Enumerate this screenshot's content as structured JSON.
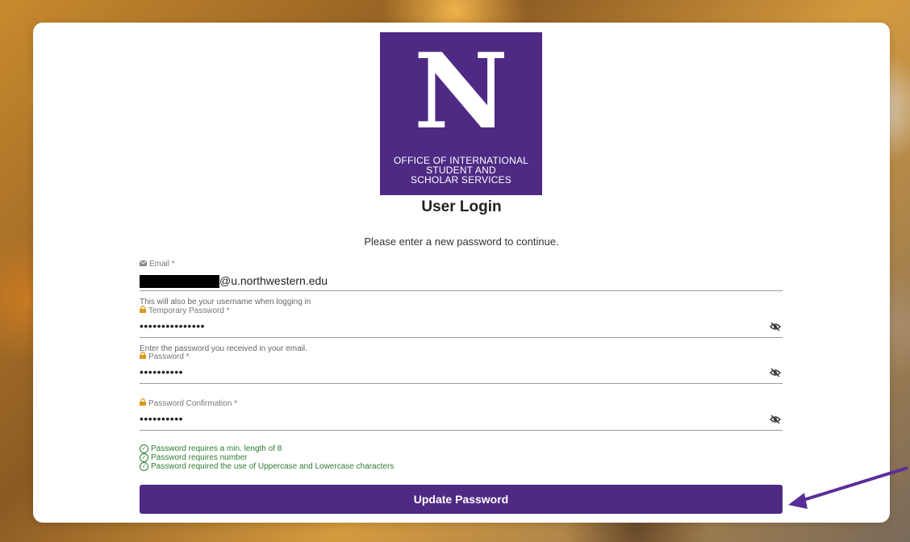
{
  "logo": {
    "letter": "N",
    "line1": "OFFICE OF INTERNATIONAL",
    "line2": "STUDENT AND",
    "line3": "SCHOLAR SERVICES"
  },
  "title": "User Login",
  "subtitle": "Please enter a new password to continue.",
  "email": {
    "label": "Email *",
    "value_suffix": "@u.northwestern.edu",
    "hint": "This will also be your username when logging in"
  },
  "temp_password": {
    "label": "Temporary Password *",
    "value": "•••••••••••••••",
    "hint": "Enter the password you received in your email."
  },
  "password": {
    "label": "Password *",
    "value": "••••••••••"
  },
  "password_confirm": {
    "label": "Password Confirmation *",
    "value": "••••••••••"
  },
  "rules": [
    "Password requires a min. length of 8",
    "Password requires number",
    "Password required the use of Uppercase and Lowercase characters"
  ],
  "button": {
    "label": "Update Password"
  },
  "colors": {
    "brand": "#4e2a84",
    "success": "#2e7d32",
    "lock": "#d89b1a"
  }
}
